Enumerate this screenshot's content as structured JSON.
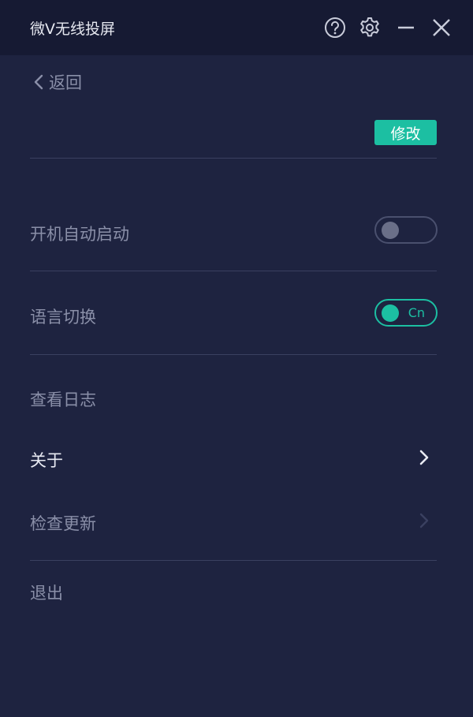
{
  "titlebar": {
    "title": "微V无线投屏",
    "icons": [
      "help-icon",
      "gear-icon",
      "minimize-icon",
      "close-icon"
    ]
  },
  "nav": {
    "back_label": "返回"
  },
  "actions": {
    "modify_label": "修改"
  },
  "settings": {
    "autostart": {
      "label": "开机自动启动",
      "enabled": false
    },
    "language": {
      "label": "语言切换",
      "enabled": true,
      "value": "Cn"
    },
    "logs": {
      "label": "查看日志"
    },
    "about": {
      "label": "关于"
    },
    "update": {
      "label": "检查更新"
    },
    "logout": {
      "label": "退出"
    }
  },
  "colors": {
    "background": "#1e2340",
    "titlebar": "#161a33",
    "accent": "#1cbfa2",
    "divider": "#3a4060",
    "text_dim": "#8a8fa8",
    "text_bright": "#e8eaf2"
  }
}
